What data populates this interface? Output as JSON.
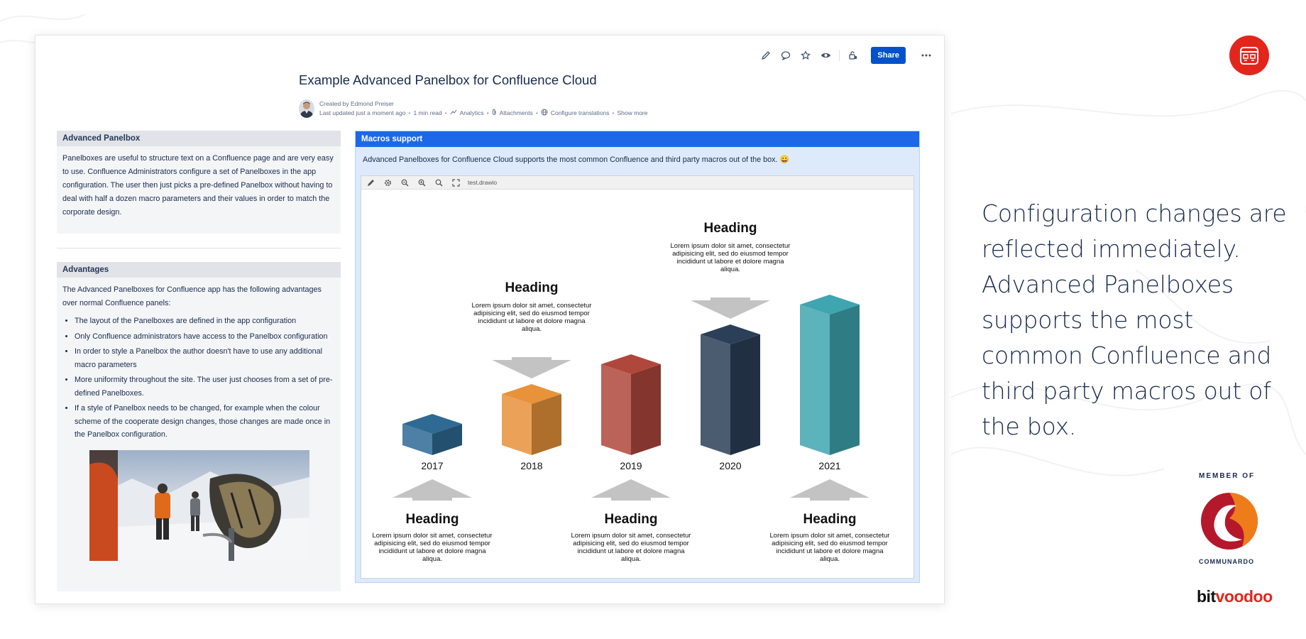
{
  "page": {
    "title": "Example Advanced Panelbox for Confluence Cloud",
    "created_by": "Created by Edmond Preiser",
    "last_updated": "Last updated just a moment ago",
    "read_time": "1 min read",
    "analytics": "Analytics",
    "attachments": "Attachments",
    "configure_translations": "Configure translations",
    "show_more": "Show more"
  },
  "toolbar": {
    "icons": [
      "edit-icon",
      "comment-icon",
      "star-icon",
      "watch-icon",
      "restrictions-icon"
    ],
    "share_label": "Share",
    "more_label": "···"
  },
  "panel1": {
    "title": "Advanced Panelbox",
    "body": "Panelboxes are useful to structure text on a Confluence page and are very easy to use. Confluence Administrators configure a set of Panelboxes in the app configuration. The user then just picks a pre-defined Panelbox without having to deal with half a dozen macro parameters and their values in order to match the corporate design."
  },
  "panel2": {
    "title": "Advantages",
    "intro": "The Advanced Panelboxes for Confluence app has the following advantages over normal Confluence panels:",
    "items": [
      "The layout of the Panelboxes are defined in the app configuration",
      "Only Confluence administrators have access to the Panelbox configuration",
      "In order to style a Panelbox the author doesn't have to use any additional macro parameters",
      "More uniformity throughout the site. The user just chooses from a set of pre-defined Panelboxes.",
      "If a style of Panelbox needs to be changed, for example when the colour scheme of the cooperate design changes, those changes are made once in the Panelbox configuration."
    ]
  },
  "macro_panel": {
    "title": "Macros support",
    "intro": "Advanced Panelboxes for Confluence Cloud supports the most common Confluence and third party macros out of the box. 😀",
    "drawio_filename": "test.drawio",
    "drawio_tools": [
      "pencil-icon",
      "gear-icon",
      "zoom-out-icon",
      "zoom-in-icon",
      "search-icon",
      "fullscreen-icon"
    ]
  },
  "chart_data": {
    "type": "bar",
    "categories": [
      "2017",
      "2018",
      "2019",
      "2020",
      "2021"
    ],
    "values": [
      1,
      2,
      3,
      4,
      5
    ],
    "colors": [
      "#2e6a94",
      "#e8923a",
      "#b0473c",
      "#2b3f58",
      "#3fa5b0"
    ],
    "annotations": [
      {
        "category": "2017",
        "position": "below",
        "heading": "Heading",
        "text": [
          "Lorem ipsum dolor sit amet, consectetur",
          "adipisicing elit, sed do eiusmod tempor",
          "incididunt ut labore et dolore magna",
          "aliqua."
        ]
      },
      {
        "category": "2018",
        "position": "above",
        "heading": "Heading",
        "text": [
          "Lorem ipsum dolor sit amet, consectetur",
          "adipisicing elit, sed do eiusmod tempor",
          "incididunt ut labore et dolore magna",
          "aliqua."
        ]
      },
      {
        "category": "2019",
        "position": "below",
        "heading": "Heading",
        "text": [
          "Lorem ipsum dolor sit amet, consectetur",
          "adipisicing elit, sed do eiusmod tempor",
          "incididunt ut labore et dolore magna",
          "aliqua."
        ]
      },
      {
        "category": "2020",
        "position": "above",
        "heading": "Heading",
        "text": [
          "Lorem ipsum dolor sit amet, consectetur",
          "adipisicing elit, sed do eiusmod tempor",
          "incididunt ut labore et dolore magna",
          "aliqua."
        ]
      },
      {
        "category": "2021",
        "position": "below",
        "heading": "Heading",
        "text": [
          "Lorem ipsum dolor sit amet, consectetur",
          "adipisicing elit, sed do eiusmod tempor",
          "incididunt ut labore et dolore magna",
          "aliqua."
        ]
      }
    ]
  },
  "marketing": {
    "headline": "Configuration changes are reflected immediately. Advanced Panelboxes supports the most common Confluence and third party macros out of the box.",
    "member_of": "MEMBER OF",
    "communardo": "COMMUNARDO",
    "bitvoodoo_bit": "bit",
    "bitvoodoo_voodoo": "voodoo",
    "brand_red": "#e3261c"
  }
}
